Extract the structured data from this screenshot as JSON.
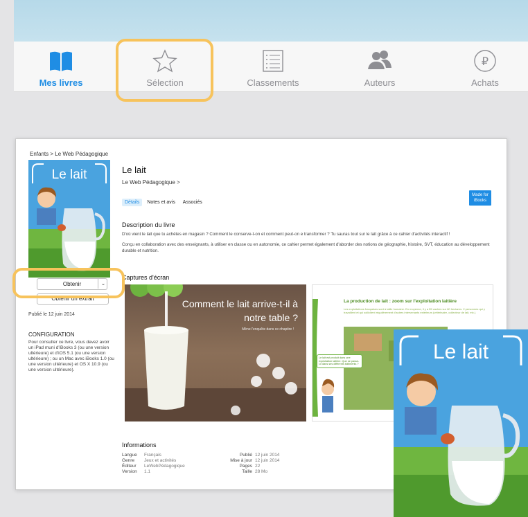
{
  "tabbar": {
    "tabs": [
      {
        "label": "Mes livres",
        "icon": "book-icon",
        "active": true
      },
      {
        "label": "Sélection",
        "icon": "star-icon",
        "active": false
      },
      {
        "label": "Classements",
        "icon": "list-icon",
        "active": false
      },
      {
        "label": "Auteurs",
        "icon": "people-icon",
        "active": false
      },
      {
        "label": "Achats",
        "icon": "purchases-icon",
        "active": false
      }
    ]
  },
  "highlight_color": "#f7c35c",
  "accent_color": "#1f8de4",
  "store": {
    "breadcrumb": "Enfants > Le Web Pédagogique",
    "cover_title": "Le lait",
    "obtenir_label": "Obtenir",
    "extrait_label": "Obtenir un extrait",
    "published": "Publié le 12 juin 2014",
    "config_title": "CONFIGURATION",
    "config_text": "Pour consulter ce livre, vous devez avoir un iPad muni d'iBooks 3 (ou une version ultérieure) et d'iOS 5.1 (ou une version ultérieure) ; ou un Mac avec iBooks 1.0 (ou une version ultérieure) et OS X 10.9 (ou une version ultérieure).",
    "book_title": "Le lait",
    "author": "Le Web Pédagogique >",
    "tabs": [
      "Détails",
      "Notes et avis",
      "Associés"
    ],
    "made_for": "Made for iBooks",
    "desc_heading": "Description du livre",
    "desc_p1": "D'où vient le lait que tu achètes en magasin ? Comment le conserve-t-on et comment peut-on e transformer ? Tu sauras tout sur le lait grâce à ce cahier d'activités interactif !",
    "desc_p2": "Conçu en collaboration avec des enseignants, à utiliser en classe ou en autonomie, ce cahier permet également d'aborder des notions de géographie, histoire, SVT, éducation au développement durable et nutrition.",
    "shots_heading": "Captures d'écran",
    "shot1_title": "Comment le lait arrive-t-il à notre table ?",
    "shot1_sub": "Mène l'enquête dans ce chapitre !",
    "shot2_title": "La production de lait : zoom sur l'exploitation laitière",
    "shot2_text": "Les exploitations françaises sont à taille humaine. En moyenne, il y a 55 vaches sur 60 hectares. 2 personnes qui y travaillent et qui sollicitent régulièrement d'autres intervenants extérieurs (vétérinaire, collecteur de lait, etc.).",
    "shot2_bubble": "Le lait est produit dans une exploitation laitière. Que se passe-t-il dans ses différents bâtiments ?",
    "info_heading": "Informations",
    "info_left": [
      {
        "k": "Langue",
        "v": "Français"
      },
      {
        "k": "Genre",
        "v": "Jeux et activités"
      },
      {
        "k": "Éditeur",
        "v": "LeWebPédagogique"
      },
      {
        "k": "Version",
        "v": "1.1"
      }
    ],
    "info_right": [
      {
        "k": "Publié",
        "v": "12 juin 2014"
      },
      {
        "k": "Mise à jour",
        "v": "12 juin 2014"
      },
      {
        "k": "Pages",
        "v": "22"
      },
      {
        "k": "Taille",
        "v": "28 Mo"
      }
    ]
  }
}
